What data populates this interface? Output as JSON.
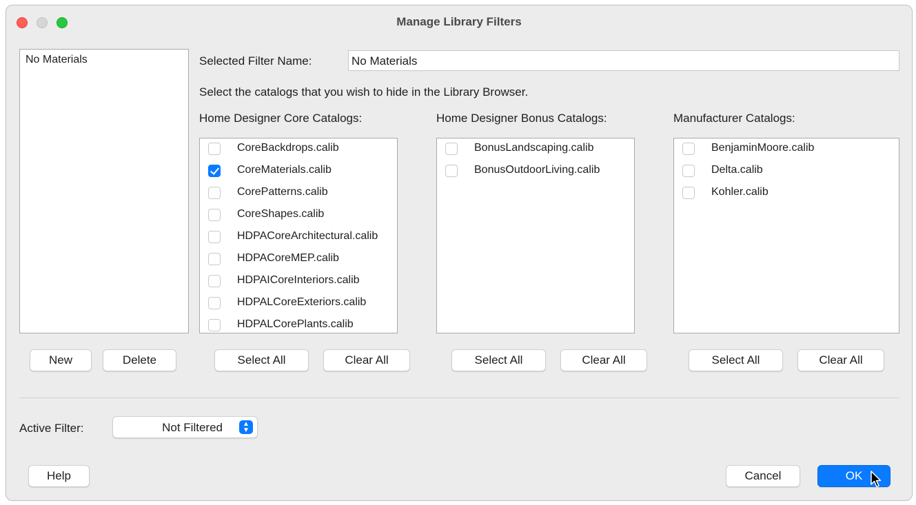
{
  "window": {
    "title": "Manage Library Filters"
  },
  "filters": {
    "items": [
      "No Materials"
    ],
    "new_label": "New",
    "delete_label": "Delete"
  },
  "selected_filter": {
    "label": "Selected Filter Name:",
    "value": "No Materials"
  },
  "instructions": "Select the catalogs that you wish to hide in the Library Browser.",
  "catalog_groups": [
    {
      "heading": "Home Designer Core Catalogs:",
      "items": [
        {
          "name": "CoreBackdrops.calib",
          "checked": false
        },
        {
          "name": "CoreMaterials.calib",
          "checked": true
        },
        {
          "name": "CorePatterns.calib",
          "checked": false
        },
        {
          "name": "CoreShapes.calib",
          "checked": false
        },
        {
          "name": "HDPACoreArchitectural.calib",
          "checked": false
        },
        {
          "name": "HDPACoreMEP.calib",
          "checked": false
        },
        {
          "name": "HDPAICoreInteriors.calib",
          "checked": false
        },
        {
          "name": "HDPALCoreExteriors.calib",
          "checked": false
        },
        {
          "name": "HDPALCorePlants.calib",
          "checked": false
        }
      ],
      "select_all_label": "Select All",
      "clear_all_label": "Clear All"
    },
    {
      "heading": "Home Designer Bonus Catalogs:",
      "items": [
        {
          "name": "BonusLandscaping.calib",
          "checked": false
        },
        {
          "name": "BonusOutdoorLiving.calib",
          "checked": false
        }
      ],
      "select_all_label": "Select All",
      "clear_all_label": "Clear All"
    },
    {
      "heading": "Manufacturer Catalogs:",
      "items": [
        {
          "name": "BenjaminMoore.calib",
          "checked": false
        },
        {
          "name": "Delta.calib",
          "checked": false
        },
        {
          "name": "Kohler.calib",
          "checked": false
        }
      ],
      "select_all_label": "Select All",
      "clear_all_label": "Clear All"
    }
  ],
  "active_filter": {
    "label": "Active Filter:",
    "value": "Not Filtered"
  },
  "footer": {
    "help_label": "Help",
    "cancel_label": "Cancel",
    "ok_label": "OK"
  },
  "colors": {
    "accent": "#0a7aff",
    "window_bg": "#ececec"
  }
}
